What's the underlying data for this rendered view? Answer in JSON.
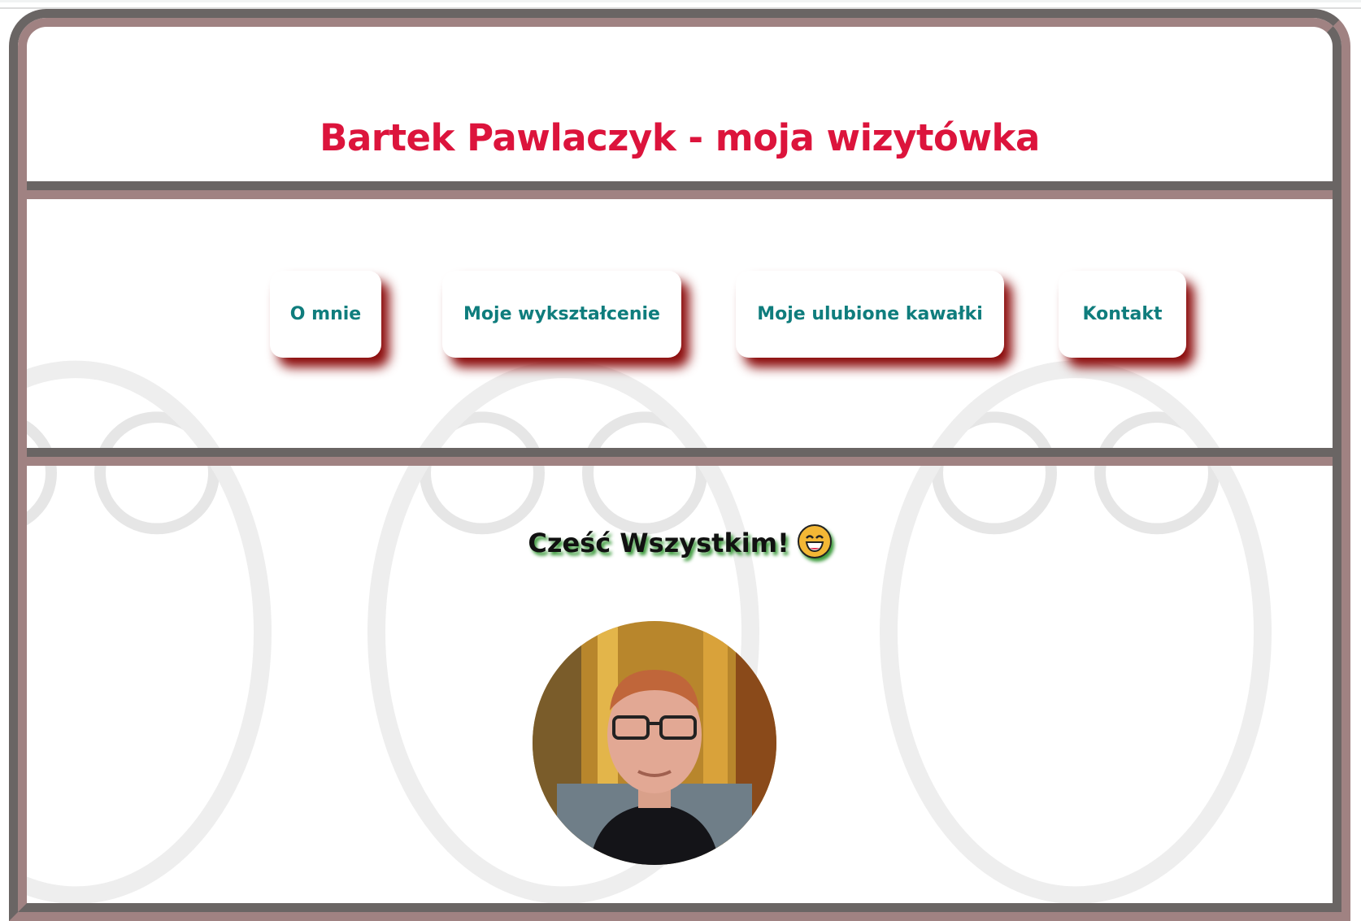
{
  "header": {
    "title": "Bartek Pawlaczyk - moja wizytówka"
  },
  "nav": {
    "items": [
      {
        "label": "O mnie"
      },
      {
        "label": "Moje wykształcenie"
      },
      {
        "label": "Moje ulubione kawałki"
      },
      {
        "label": "Kontakt"
      }
    ]
  },
  "main": {
    "greeting": "Cześć Wszystkim!",
    "greeting_emoji": "grinning-face-icon",
    "photo": "profile-photo"
  },
  "colors": {
    "title": "#dc143c",
    "nav_text": "#0f7d7d",
    "nav_shadow": "#8b0a0a",
    "border_dark": "#6a6564",
    "border_light": "#a08282"
  }
}
